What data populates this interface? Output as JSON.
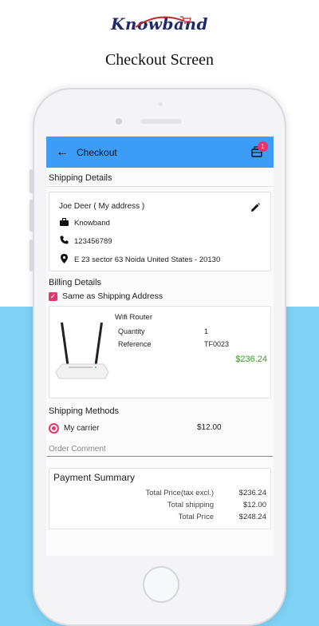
{
  "brand": {
    "logo_text": "Knowband"
  },
  "page_title": "Checkout Screen",
  "colors": {
    "accent_blue": "#3d9cf5",
    "badge_pink": "#e8336b",
    "price_green": "#3a9a2e",
    "bg_light_blue": "#7fd2f4"
  },
  "appbar": {
    "title": "Checkout",
    "cart_count": "1"
  },
  "shipping": {
    "label": "Shipping Details",
    "name": "Joe Deer ( My address )",
    "company": "Knowband",
    "phone": "123456789",
    "address": "E 23 sector 63 Noida United States - 20130"
  },
  "billing": {
    "label": "Billing Details",
    "same_as_shipping": "Same as Shipping Address"
  },
  "product": {
    "name": "Wifi Router",
    "quantity_label": "Quantity",
    "quantity": "1",
    "reference_label": "Reference",
    "reference": "TF0023",
    "price": "$236.24"
  },
  "shipping_methods": {
    "label": "Shipping Methods",
    "carrier": "My carrier",
    "price": "$12.00"
  },
  "order_comment": {
    "placeholder": "Order Comment"
  },
  "payment_summary": {
    "title": "Payment Summary",
    "rows": [
      {
        "label": "Total Price(tax excl.)",
        "value": "$236.24"
      },
      {
        "label": "Total shipping",
        "value": "$12.00"
      },
      {
        "label": "Total Price",
        "value": "$248.24"
      }
    ]
  }
}
